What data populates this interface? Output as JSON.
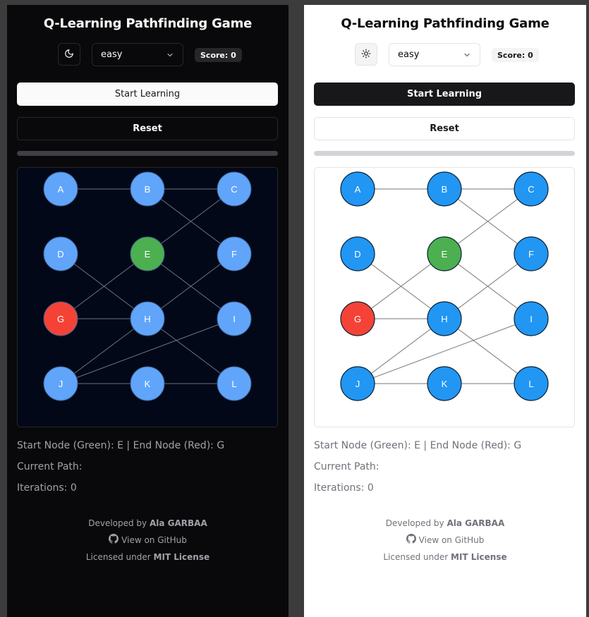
{
  "title": "Q-Learning Pathfinding Game",
  "difficulty": "easy",
  "score_label": "Score: 0",
  "start_button": "Start Learning",
  "reset_button": "Reset",
  "progress_fraction": 0,
  "start_end_text": "Start Node (Green): E | End Node (Red): G",
  "current_path_text": "Current Path:",
  "iterations_text": "Iterations: 0",
  "footer": {
    "developed_by_prefix": "Developed by",
    "author": "Ala GARBAA",
    "github_link": "View on GitHub",
    "license_prefix": "Licensed under",
    "license": "MIT License"
  },
  "graph": {
    "nodes": [
      "A",
      "B",
      "C",
      "D",
      "E",
      "F",
      "G",
      "H",
      "I",
      "J",
      "K",
      "L"
    ],
    "start_node": "E",
    "end_node": "G",
    "edges": [
      [
        "A",
        "B"
      ],
      [
        "B",
        "C"
      ],
      [
        "B",
        "F"
      ],
      [
        "C",
        "E"
      ],
      [
        "D",
        "H"
      ],
      [
        "E",
        "I"
      ],
      [
        "E",
        "G"
      ],
      [
        "G",
        "H"
      ],
      [
        "H",
        "F"
      ],
      [
        "H",
        "J"
      ],
      [
        "H",
        "L"
      ],
      [
        "I",
        "J"
      ],
      [
        "J",
        "K"
      ],
      [
        "K",
        "L"
      ]
    ]
  },
  "colors": {
    "node_dark": "#60a5fa",
    "node_light": "#2196f3",
    "start": "#4caf50",
    "end": "#f44336"
  }
}
